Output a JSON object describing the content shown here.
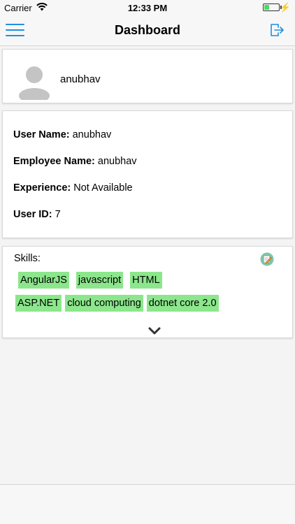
{
  "status_bar": {
    "carrier": "Carrier",
    "time": "12:33 PM",
    "battery_level": 0.35
  },
  "nav": {
    "title": "Dashboard",
    "menu_icon": "hamburger-menu-icon",
    "logout_icon": "logout-icon",
    "accent_color": "#1f8fe0"
  },
  "profile": {
    "name": "anubhav",
    "avatar_icon": "default-avatar-icon"
  },
  "info": {
    "user_name_label": "User Name:",
    "user_name_value": " anubhav",
    "employee_name_label": "Employee Name:",
    "employee_name_value": " anubhav",
    "experience_label": "Experience:",
    "experience_value": " Not Available",
    "user_id_label": "User ID:",
    "user_id_value": " 7"
  },
  "skills": {
    "title": "Skills:",
    "edit_icon": "edit-note-icon",
    "expand_icon": "chevron-down-icon",
    "tag_color": "#8ce68c",
    "rows": [
      [
        "AngularJS",
        "javascript",
        "HTML"
      ],
      [
        "ASP.NET",
        "cloud computing",
        "dotnet core 2.0"
      ]
    ]
  }
}
